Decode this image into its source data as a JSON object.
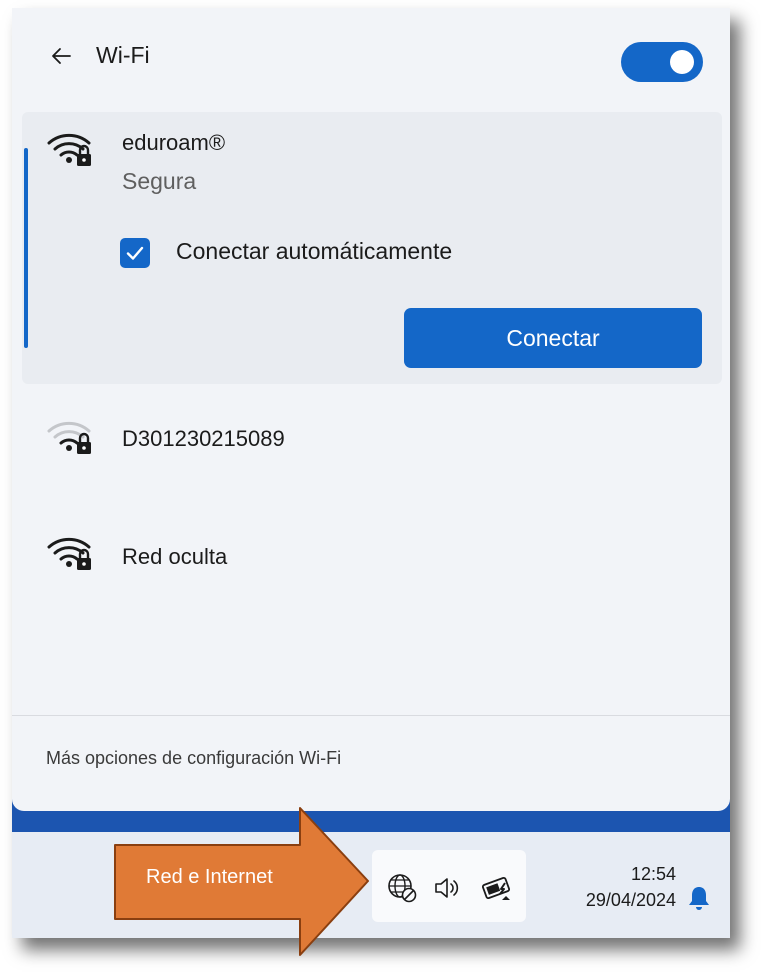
{
  "wifi_panel": {
    "title": "Wi-Fi",
    "toggle_on": true,
    "networks": [
      {
        "name": "eduroam®",
        "security": "Segura",
        "expanded": true,
        "auto_connect_label": "Conectar automáticamente",
        "auto_connect_checked": true,
        "connect_label": "Conectar",
        "signal": "full"
      },
      {
        "name": "D301230215089",
        "signal": "weak"
      },
      {
        "name": "Red oculta",
        "signal": "full"
      }
    ],
    "more_options": "Más opciones de configuración Wi-Fi"
  },
  "taskbar": {
    "time": "12:54",
    "date": "29/04/2024"
  },
  "annotation": {
    "label": "Red e Internet",
    "color": "#e07a36"
  },
  "colors": {
    "accent": "#1467c8",
    "panel_bg": "#f2f4f8",
    "taskbar_bg": "#e7ecf4"
  }
}
